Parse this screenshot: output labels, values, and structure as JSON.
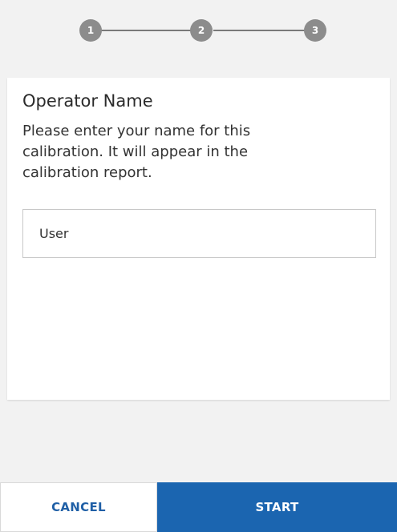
{
  "stepper": {
    "steps": [
      {
        "label": "1"
      },
      {
        "label": "2"
      },
      {
        "label": "3"
      }
    ]
  },
  "card": {
    "title": "Operator Name",
    "description": "Please enter your name for this calibration. It will appear in the calibration report.",
    "input": {
      "value": "User"
    }
  },
  "actions": {
    "cancel_label": "CANCEL",
    "start_label": "START"
  },
  "colors": {
    "primary": "#1b65b0",
    "cancel_text": "#1f5fa6",
    "step_dot": "#8c8c8c",
    "background": "#f2f2f2"
  }
}
